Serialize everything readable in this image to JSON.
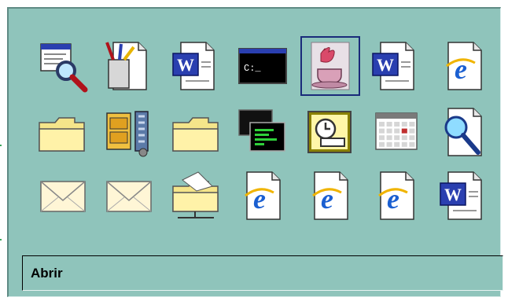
{
  "colors": {
    "panel_bg": "#8fc4bb",
    "selection": "#1a2b7a"
  },
  "icons": [
    {
      "name": "find-window-icon"
    },
    {
      "name": "toolbox-icon"
    },
    {
      "name": "word-document-icon"
    },
    {
      "name": "command-prompt-icon"
    },
    {
      "name": "java-cup-icon",
      "selected": true
    },
    {
      "name": "word-document-icon"
    },
    {
      "name": "ie-document-icon"
    },
    {
      "name": "folder-icon"
    },
    {
      "name": "file-cabinet-clamp-icon"
    },
    {
      "name": "folder-icon"
    },
    {
      "name": "terminal-windows-icon"
    },
    {
      "name": "outlook-clock-icon"
    },
    {
      "name": "calendar-document-icon"
    },
    {
      "name": "search-document-icon"
    },
    {
      "name": "envelope-icon"
    },
    {
      "name": "envelope-icon"
    },
    {
      "name": "network-folder-icon"
    },
    {
      "name": "ie-document-icon"
    },
    {
      "name": "ie-document-icon"
    },
    {
      "name": "ie-document-icon"
    },
    {
      "name": "word-document-icon"
    }
  ],
  "status_bar": {
    "text": "Abrir"
  }
}
